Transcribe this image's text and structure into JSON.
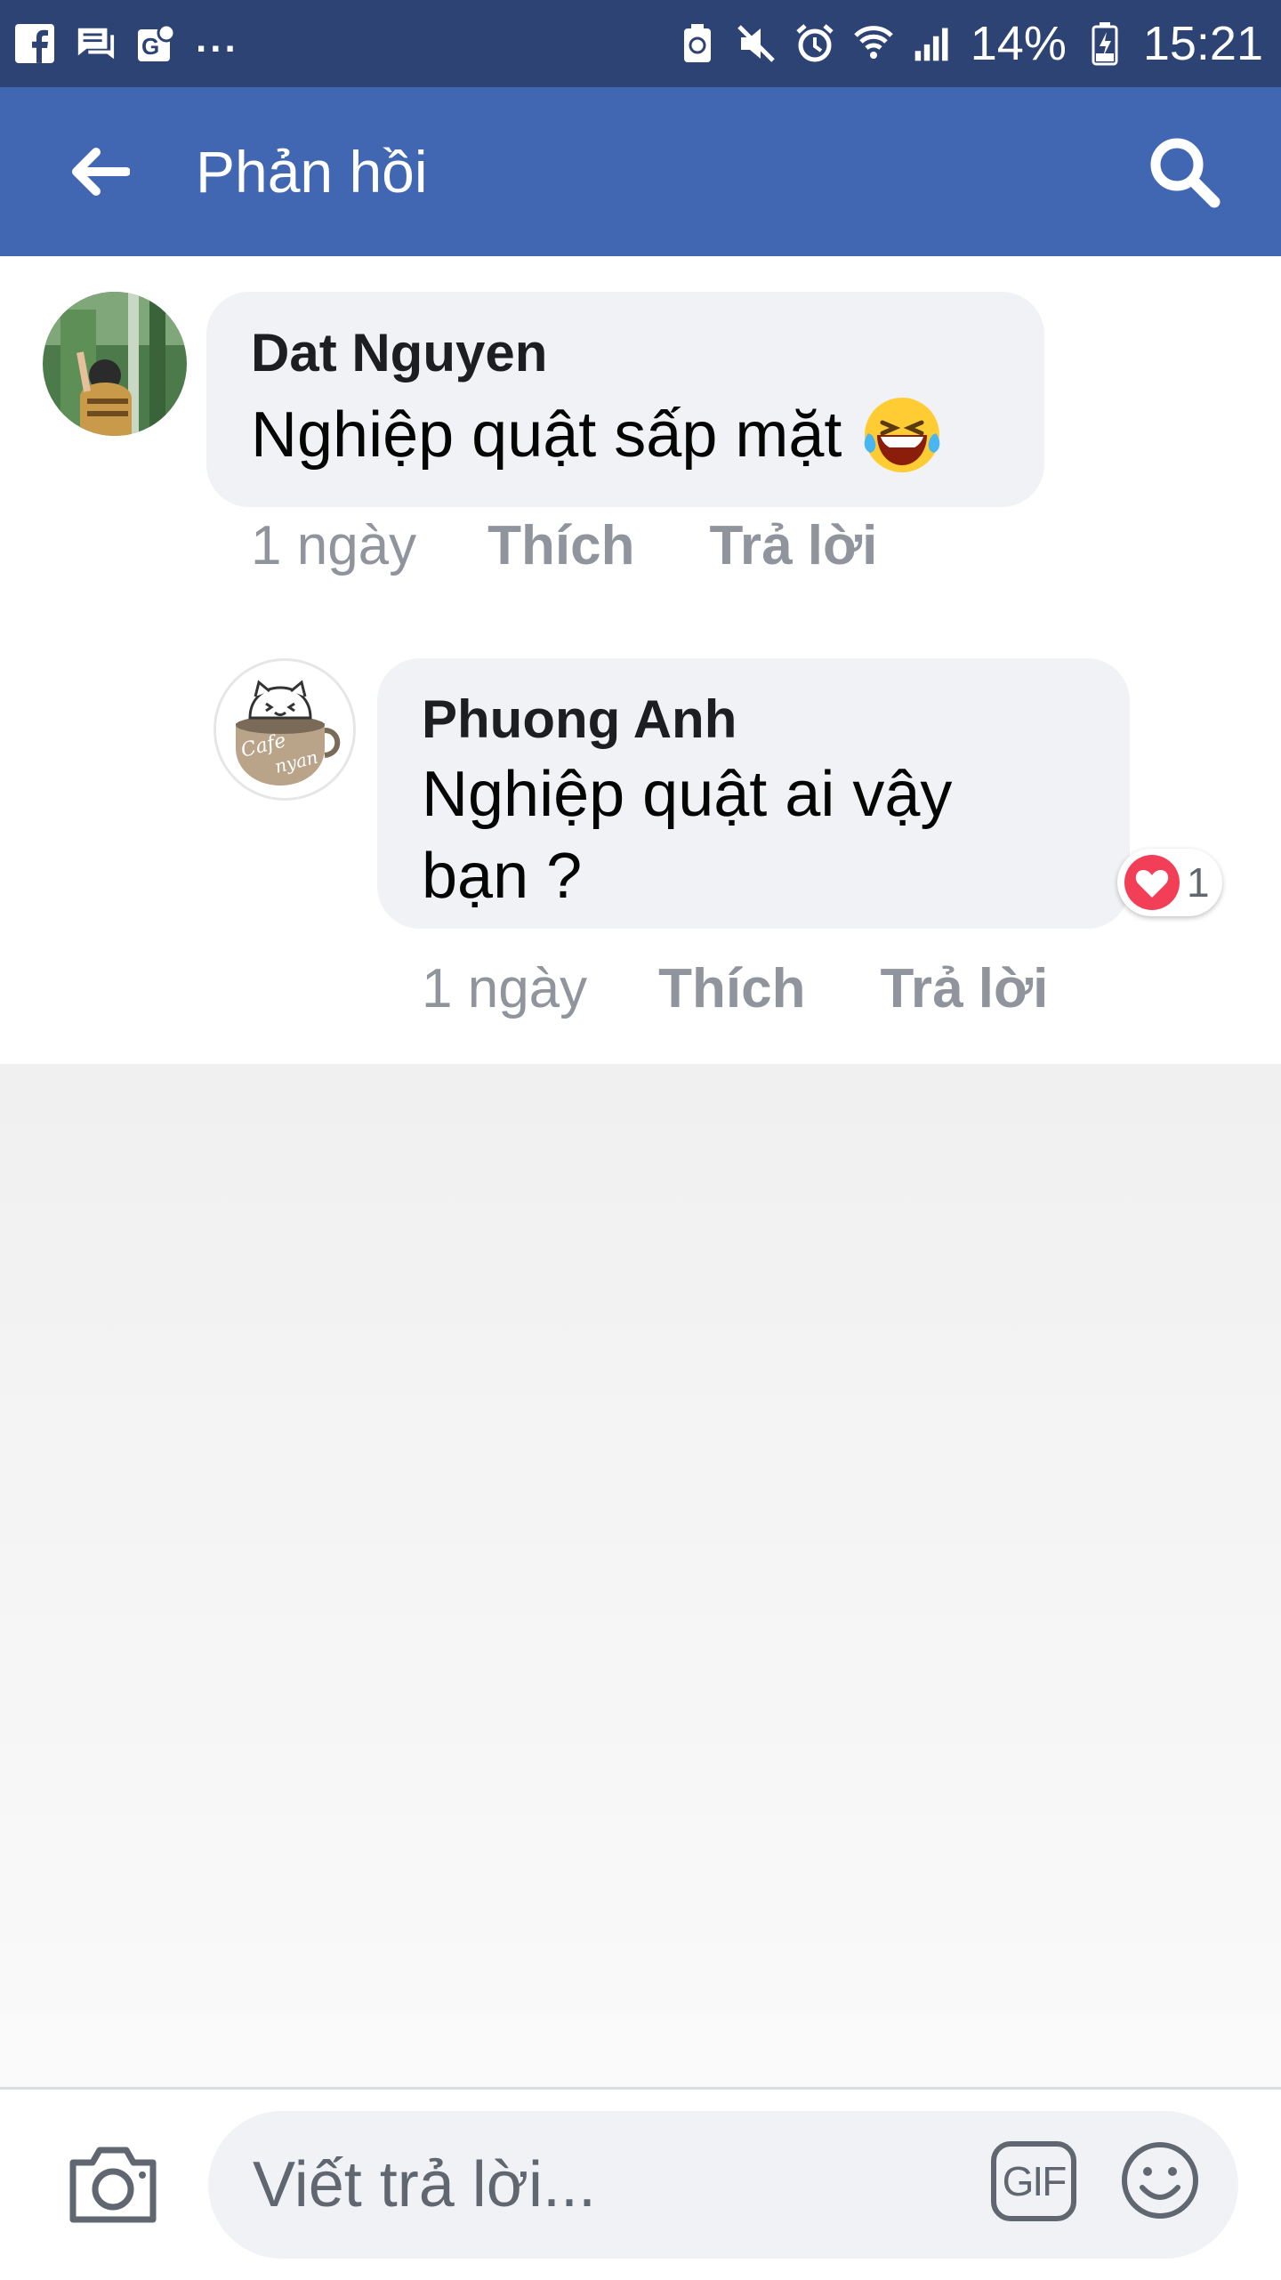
{
  "status_bar": {
    "battery": "14%",
    "time": "15:21",
    "dots": "..."
  },
  "header": {
    "title": "Phản hồi"
  },
  "comments": [
    {
      "author": "Dat Nguyen",
      "text": "Nghiệp quật sấp mặt",
      "emoji": "😂",
      "time": "1 ngày",
      "like_label": "Thích",
      "reply_label": "Trả lời"
    },
    {
      "author": "Phuong Anh",
      "text_line1": "Nghiệp quật ai vậy",
      "text_line2": "bạn ?",
      "time": "1 ngày",
      "like_label": "Thích",
      "reply_label": "Trả lời",
      "reaction_icon": "heart-icon",
      "reaction_count": "1",
      "avatar_text1": "Cafe",
      "avatar_text2": "nyan"
    }
  ],
  "composer": {
    "placeholder": "Viết trả lời...",
    "gif_label": "GIF"
  },
  "colors": {
    "status_bar": "#2d4373",
    "header": "#4267b2",
    "bubble": "#f1f2f5",
    "meta_text": "#90949c",
    "heart": "#f33e58"
  }
}
